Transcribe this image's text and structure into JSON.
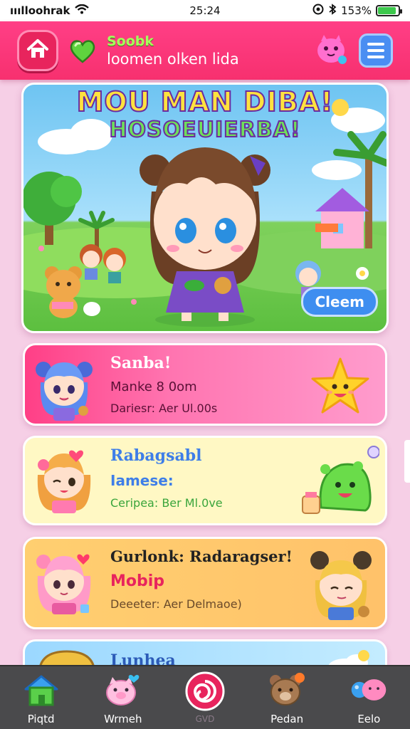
{
  "status_bar": {
    "carrier": "ııılloohrak",
    "time": "25:24",
    "battery": "153%",
    "battery_level": 0.9
  },
  "header": {
    "title": "Soobk",
    "subtitle": "loomen olken lida",
    "icons": [
      "home-icon",
      "heart-icon",
      "pink-mascot-icon",
      "menu-icon"
    ]
  },
  "hero": {
    "title_line1": "MOU MAN DIBA!",
    "title_line2": "HOSOEUIERBA!",
    "button_label": "Cleem"
  },
  "cards": [
    {
      "title": "Sanba!",
      "line2": "Manke 8 0om",
      "line3": "Dariesr: Aer Ul.00s",
      "deco": "star-icon"
    },
    {
      "title": "Rabagsabl",
      "line2": "Iamese:",
      "line3": "Ceripea: Ber Ml.0ve",
      "deco": "slime-icon"
    },
    {
      "title": "Gurlonk: Radaragser!",
      "line2": "Mobip",
      "line3": "Deeeter: Aer Delmaoe)",
      "deco": "bear-ears-avatar"
    },
    {
      "title": "Lunhea",
      "deco": "cloud-icon"
    }
  ],
  "bottom_nav": [
    {
      "label": "Piqtd",
      "icon": "house-icon"
    },
    {
      "label": "Wrmeh",
      "icon": "pig-icon"
    },
    {
      "label": "GVD",
      "icon": "lollipop-icon"
    },
    {
      "label": "Pedan",
      "icon": "bear-icon"
    },
    {
      "label": "Eelo",
      "icon": "bubbles-icon"
    }
  ],
  "colors": {
    "header": "#f7306f",
    "background": "#f6cfe6",
    "menu_button": "#4a8ef2",
    "nav_bar": "#4a4a4c"
  }
}
